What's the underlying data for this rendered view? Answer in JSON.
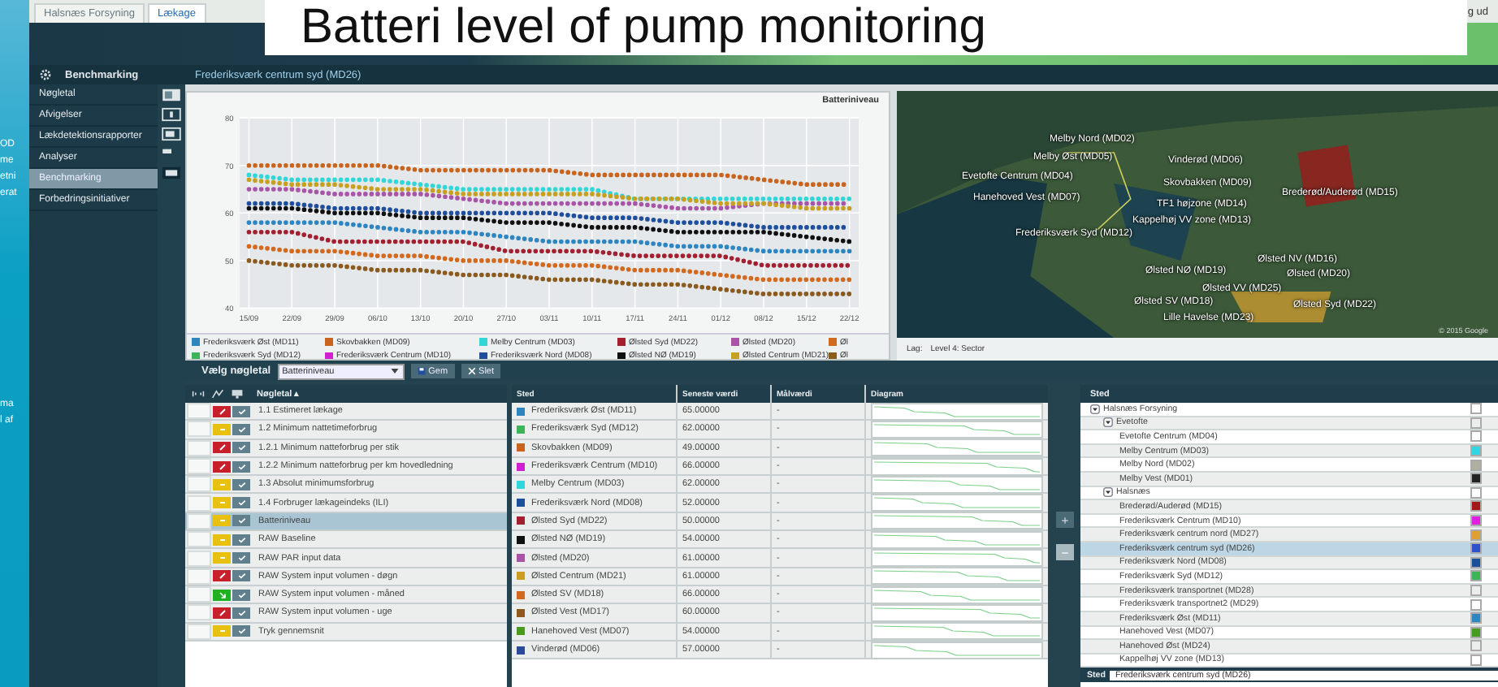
{
  "slide": {
    "title": "Batteri level of pump monitoring",
    "fragments": [
      "OD",
      "me",
      "etni",
      "erat",
      "ma",
      "l af"
    ]
  },
  "top_tabs": [
    {
      "label": "Halsnæs Forsyning",
      "selected": false
    },
    {
      "label": "Lækage",
      "selected": true
    }
  ],
  "logout": "g ud",
  "sidebar": {
    "header": "Benchmarking",
    "items": [
      {
        "label": "Nøgletal",
        "selected": false
      },
      {
        "label": "Afvigelser",
        "selected": false
      },
      {
        "label": "Lækdetektionsrapporter",
        "selected": false
      },
      {
        "label": "Analyser",
        "selected": false
      },
      {
        "label": "Benchmarking",
        "selected": true
      },
      {
        "label": "Forbedringsinitiativer",
        "selected": false
      }
    ]
  },
  "page_title": "Frederiksværk centrum syd (MD26)",
  "chart_panel": {
    "chart_data": {
      "type": "line",
      "grid": true,
      "legend": true,
      "title": "Batteriniveau",
      "x": [
        "15/09",
        "22/09",
        "29/09",
        "06/10",
        "13/10",
        "20/10",
        "27/10",
        "03/11",
        "10/11",
        "17/11",
        "24/11",
        "01/12",
        "08/12",
        "15/12",
        "22/12"
      ],
      "ylim": [
        40,
        80
      ],
      "yticks": [
        40,
        50,
        60,
        70,
        80
      ],
      "series": [
        {
          "name": "Frederiksværk Øst (MD11)",
          "color": "#2e86c1",
          "line_style": "dotted",
          "values": [
            58,
            58,
            58,
            57,
            56,
            56,
            55,
            54,
            54,
            54,
            53,
            53,
            52,
            52,
            52
          ]
        },
        {
          "name": "Skovbakken (MD09)",
          "color": "#c8641e",
          "line_style": "dotted",
          "values": [
            70,
            70,
            70,
            70,
            69,
            69,
            69,
            69,
            68,
            68,
            68,
            68,
            67,
            66,
            66
          ]
        },
        {
          "name": "Melby Centrum (MD03)",
          "color": "#33d6d6",
          "line_style": "dotted",
          "values": [
            68,
            67,
            67,
            67,
            66,
            65,
            65,
            65,
            65,
            63,
            63,
            63,
            63,
            63,
            63
          ]
        },
        {
          "name": "Ølsted Syd (MD22)",
          "color": "#a32030",
          "line_style": "dotted",
          "values": [
            56,
            56,
            54,
            54,
            54,
            54,
            52,
            52,
            52,
            51,
            51,
            51,
            49,
            49,
            49
          ]
        },
        {
          "name": "Ølsted (MD20)",
          "color": "#a855a8",
          "line_style": "dotted",
          "values": [
            65,
            65,
            64,
            64,
            64,
            63,
            62,
            62,
            62,
            62,
            61,
            61,
            62,
            62,
            62
          ]
        },
        {
          "name": "Øl",
          "color": "#d2691e",
          "line_style": "dotted",
          "values": [
            53,
            52,
            52,
            51,
            51,
            50,
            50,
            49,
            49,
            48,
            48,
            47,
            46,
            46,
            46
          ]
        },
        {
          "name": "Frederiksværk Syd (MD12)",
          "color": "#3cb45a",
          "values": [
            null,
            null,
            null,
            null,
            null,
            null,
            null,
            null,
            null,
            null,
            null,
            null,
            null,
            null,
            null
          ]
        },
        {
          "name": "Frederiksværk Centrum (MD10)",
          "color": "#d020d0",
          "values": [
            null,
            null,
            null,
            null,
            null,
            null,
            null,
            null,
            null,
            null,
            null,
            null,
            null,
            null,
            null
          ]
        },
        {
          "name": "Frederiksværk Nord (MD08)",
          "color": "#1f4e9c",
          "line_style": "dotted",
          "values": [
            62,
            62,
            61,
            61,
            60,
            60,
            60,
            60,
            59,
            59,
            58,
            58,
            57,
            57,
            57
          ]
        },
        {
          "name": "Ølsted NØ (MD19)",
          "color": "#111111",
          "line_style": "dotted",
          "values": [
            61,
            61,
            60,
            60,
            59,
            59,
            58,
            58,
            57,
            57,
            56,
            56,
            56,
            55,
            54
          ]
        },
        {
          "name": "Ølsted Centrum (MD21)",
          "color": "#c8a020",
          "line_style": "dotted",
          "values": [
            67,
            66,
            66,
            65,
            65,
            64,
            64,
            64,
            64,
            63,
            63,
            62,
            62,
            61,
            61
          ]
        },
        {
          "name": "Øl",
          "color": "#8b5a1e",
          "line_style": "dotted",
          "values": [
            50,
            49,
            49,
            48,
            48,
            47,
            47,
            46,
            46,
            45,
            45,
            44,
            43,
            43,
            43
          ]
        }
      ]
    }
  },
  "toolbar": {
    "label": "Vælg nøgletal",
    "dropdown": "Batteriniveau",
    "buttons": [
      {
        "kind": "save",
        "label": "Gem"
      },
      {
        "kind": "delete",
        "label": "Slet"
      }
    ]
  },
  "map": {
    "labels": [
      "Melby Nord (MD02)",
      "Melby Øst (MD05)",
      "Vinderød (MD06)",
      "Evetofte Centrum (MD04)",
      "Skovbakken (MD09)",
      "Brederød/Auderød (MD15)",
      "Hanehoved Vest (MD07)",
      "TF1 højzone (MD14)",
      "Kappelhøj VV zone (MD13)",
      "Frederiksværk Syd (MD12)",
      "Ølsted NV (MD16)",
      "Ølsted NØ (MD19)",
      "Ølsted (MD20)",
      "Ølsted VV (MD25)",
      "Ølsted SV (MD18)",
      "Ølsted Syd (MD22)",
      "Lille Havelse (MD23)"
    ],
    "copyright": "© 2015 Google",
    "layer_label": "Lag:",
    "layer_value": "Level 4: Sector"
  },
  "kpi_table": {
    "column": "Nøgletal ▴",
    "rows": [
      {
        "label": "1.1 Estimeret lækage",
        "kind": "alarm",
        "color": "#c8202a",
        "selected": false
      },
      {
        "label": "1.2 Minimum nattetimeforbrug",
        "kind": "warning",
        "color": "#e8c010",
        "selected": false
      },
      {
        "label": "1.2.1 Minimum natteforbrug per stik",
        "kind": "alarm",
        "color": "#c8202a",
        "selected": false
      },
      {
        "label": "1.2.2 Minimum natteforbrug per km hovedledning",
        "kind": "alarm",
        "color": "#c8202a",
        "selected": false
      },
      {
        "label": "1.3 Absolut minimumsforbrug",
        "kind": "warning",
        "color": "#e8c010",
        "selected": false
      },
      {
        "label": "1.4 Forbruger lækageindeks (ILI)",
        "kind": "warning",
        "color": "#e8c010",
        "selected": false
      },
      {
        "label": "Batteriniveau",
        "kind": "warning",
        "color": "#e8c010",
        "selected": true
      },
      {
        "label": "RAW Baseline",
        "kind": "warning",
        "color": "#e8c010",
        "selected": false
      },
      {
        "label": "RAW PAR input data",
        "kind": "warning",
        "color": "#e8c010",
        "selected": false
      },
      {
        "label": "RAW System input volumen - døgn",
        "kind": "alarm",
        "color": "#c8202a",
        "selected": false
      },
      {
        "label": "RAW System input volumen - måned",
        "kind": "ok",
        "color": "#20b020",
        "selected": false
      },
      {
        "label": "RAW System input volumen - uge",
        "kind": "alarm",
        "color": "#c8202a",
        "selected": false
      },
      {
        "label": "Tryk gennemsnit",
        "kind": "warning",
        "color": "#e8c010",
        "selected": false
      }
    ]
  },
  "value_table": {
    "columns": [
      "Sted",
      "Seneste værdi",
      "Målværdi",
      "Diagram"
    ],
    "rows": [
      {
        "place": "Frederiksværk Øst (MD11)",
        "color": "#2e86c1",
        "value": "65.00000",
        "target": "-"
      },
      {
        "place": "Frederiksværk Syd (MD12)",
        "color": "#3cb45a",
        "value": "62.00000",
        "target": "-"
      },
      {
        "place": "Skovbakken (MD09)",
        "color": "#c8641e",
        "value": "49.00000",
        "target": "-"
      },
      {
        "place": "Frederiksværk Centrum (MD10)",
        "color": "#d020d0",
        "value": "66.00000",
        "target": "-"
      },
      {
        "place": "Melby Centrum (MD03)",
        "color": "#33d6d6",
        "value": "62.00000",
        "target": "-"
      },
      {
        "place": "Frederiksværk Nord (MD08)",
        "color": "#1f4e9c",
        "value": "52.00000",
        "target": "-"
      },
      {
        "place": "Ølsted Syd (MD22)",
        "color": "#a32030",
        "value": "50.00000",
        "target": "-"
      },
      {
        "place": "Ølsted NØ (MD19)",
        "color": "#111111",
        "value": "54.00000",
        "target": "-"
      },
      {
        "place": "Ølsted (MD20)",
        "color": "#a855a8",
        "value": "61.00000",
        "target": "-"
      },
      {
        "place": "Ølsted Centrum (MD21)",
        "color": "#c8a020",
        "value": "61.00000",
        "target": "-"
      },
      {
        "place": "Ølsted SV (MD18)",
        "color": "#d2691e",
        "value": "66.00000",
        "target": "-"
      },
      {
        "place": "Ølsted Vest (MD17)",
        "color": "#8b5a1e",
        "value": "60.00000",
        "target": "-"
      },
      {
        "place": "Hanehoved Vest (MD07)",
        "color": "#4a9a20",
        "value": "54.00000",
        "target": "-"
      },
      {
        "place": "Vinderød (MD06)",
        "color": "#2a4a9a",
        "value": "57.00000",
        "target": "-"
      }
    ]
  },
  "tree": {
    "header": "Sted",
    "items": [
      {
        "label": "Halsnæs Forsyning",
        "expanded": true,
        "selected": false,
        "children": [
          {
            "label": "Evetofte",
            "expanded": true,
            "selected": false,
            "children": [
              {
                "label": "Evetofte Centrum (MD04)",
                "selected": false
              },
              {
                "label": "Melby Centrum (MD03)",
                "selected": false,
                "color": "#33d6e0"
              },
              {
                "label": "Melby Nord (MD02)",
                "selected": false,
                "color": "#b0b0a0"
              },
              {
                "label": "Melby Vest (MD01)",
                "selected": false,
                "color": "#222222"
              }
            ]
          },
          {
            "label": "Halsnæs",
            "expanded": true,
            "selected": false,
            "children": [
              {
                "label": "Brederød/Auderød (MD15)",
                "selected": false,
                "color": "#a01818"
              },
              {
                "label": "Frederiksværk Centrum (MD10)",
                "selected": false,
                "color": "#e020e0"
              },
              {
                "label": "Frederiksværk centrum nord (MD27)",
                "selected": false,
                "color": "#e0a030"
              },
              {
                "label": "Frederiksværk centrum syd (MD26)",
                "selected": true,
                "color": "#3050d0"
              },
              {
                "label": "Frederiksværk Nord (MD08)",
                "selected": false,
                "color": "#1f4e9c"
              },
              {
                "label": "Frederiksværk Syd (MD12)",
                "selected": false,
                "color": "#3cb45a"
              },
              {
                "label": "Frederiksværk transportnet (MD28)",
                "selected": false
              },
              {
                "label": "Frederiksværk transportnet2 (MD29)",
                "selected": false
              },
              {
                "label": "Frederiksværk Øst (MD11)",
                "selected": false,
                "color": "#2e86c1"
              },
              {
                "label": "Hanehoved Vest (MD07)",
                "selected": false,
                "color": "#4a9a20"
              },
              {
                "label": "Hanehoved Øst (MD24)",
                "selected": false
              },
              {
                "label": "Kappelhøj VV zone (MD13)",
                "selected": false
              }
            ]
          }
        ]
      }
    ],
    "footer_label": "Sted",
    "footer_value": "Frederiksværk centrum syd (MD26)"
  }
}
